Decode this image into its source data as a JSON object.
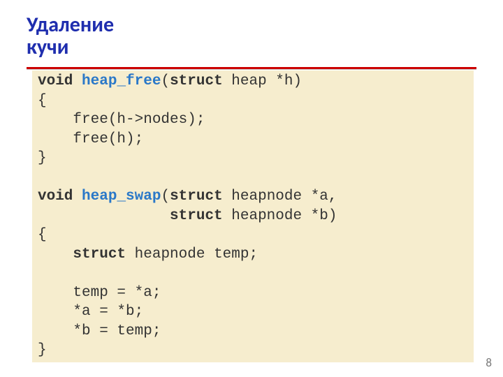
{
  "title_line1": "Удаление",
  "title_line2": "кучи",
  "page_number": "8",
  "code": {
    "l1": {
      "kw1": "void",
      "fn": "heap_free",
      "rest1": "(",
      "kw2": "struct",
      "rest2": " heap *h)"
    },
    "l2": "{",
    "l3": "    free(h->nodes);",
    "l4": "    free(h);",
    "l5": "}",
    "l6": "",
    "l7": {
      "kw1": "void",
      "fn": "heap_swap",
      "rest1": "(",
      "kw2": "struct",
      "rest2": " heapnode *a,"
    },
    "l8": {
      "pad": "               ",
      "kw": "struct",
      "rest": " heapnode *b)"
    },
    "l9": "{",
    "l10": {
      "pad": "    ",
      "kw": "struct",
      "rest": " heapnode temp;"
    },
    "l11": "",
    "l12": "    temp = *a;",
    "l13": "    *a = *b;",
    "l14": "    *b = temp;",
    "l15": "}"
  }
}
